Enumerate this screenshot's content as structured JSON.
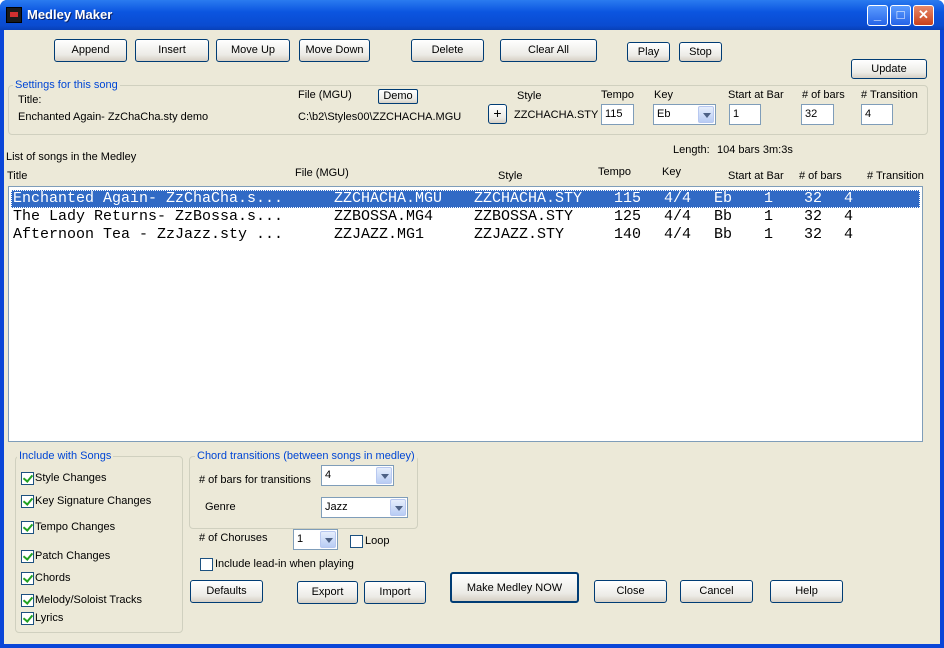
{
  "window": {
    "title": "Medley Maker"
  },
  "toolbar": {
    "append": "Append",
    "insert": "Insert",
    "move_up": "Move Up",
    "move_down": "Move Down",
    "delete": "Delete",
    "clear_all": "Clear All",
    "play": "Play",
    "stop": "Stop",
    "update": "Update"
  },
  "settings": {
    "group_title": "Settings for this song",
    "title_label": "Title:",
    "title_value": "Enchanted Again- ZzChaCha.sty demo",
    "file_label": "File (MGU)",
    "demo_button": "Demo",
    "file_value": "C:\\b2\\Styles00\\ZZCHACHA.MGU",
    "plus_button": "+",
    "style_label": "Style",
    "style_value": "ZZCHACHA.STY",
    "tempo_label": "Tempo",
    "tempo_value": "115",
    "key_label": "Key",
    "key_value": "Eb",
    "start_label": "Start at Bar",
    "start_value": "1",
    "bars_label": "# of bars",
    "bars_value": "32",
    "transition_label": "# Transition",
    "transition_value": "4"
  },
  "list": {
    "heading": "List of songs in the Medley",
    "length_label": "Length:",
    "length_value": "104 bars  3m:3s",
    "columns": {
      "title": "Title",
      "file": "File (MGU)",
      "style": "Style",
      "tempo": "Tempo",
      "key": "Key",
      "start": "Start at Bar",
      "bars": "# of bars",
      "transition": "# Transition"
    },
    "rows": [
      {
        "title": "Enchanted Again- ZzChaCha.s...",
        "file": "ZZCHACHA.MGU",
        "style": "ZZCHACHA.STY",
        "tempo": "115",
        "time": "4/4",
        "key": "Eb",
        "start": "1",
        "bars": "32",
        "transition": "4"
      },
      {
        "title": "The Lady Returns- ZzBossa.s...",
        "file": "ZZBOSSA.MG4",
        "style": "ZZBOSSA.STY",
        "tempo": "125",
        "time": "4/4",
        "key": "Bb",
        "start": "1",
        "bars": "32",
        "transition": "4"
      },
      {
        "title": "Afternoon Tea - ZzJazz.sty ...",
        "file": "ZZJAZZ.MG1",
        "style": "ZZJAZZ.STY",
        "tempo": "140",
        "time": "4/4",
        "key": "Bb",
        "start": "1",
        "bars": "32",
        "transition": "4"
      }
    ]
  },
  "include": {
    "group_title": "Include with Songs",
    "items": [
      {
        "label": "Style Changes",
        "checked": true
      },
      {
        "label": "Key Signature Changes",
        "checked": true
      },
      {
        "label": "Tempo Changes",
        "checked": true
      },
      {
        "label": "Patch Changes",
        "checked": true
      },
      {
        "label": "Chords",
        "checked": true
      },
      {
        "label": "Melody/Soloist Tracks",
        "checked": true
      },
      {
        "label": "Lyrics",
        "checked": true
      }
    ]
  },
  "transitions": {
    "group_title": "Chord transitions (between songs in medley)",
    "bars_label": "# of bars for transitions",
    "bars_value": "4",
    "genre_label": "Genre",
    "genre_value": "Jazz"
  },
  "choruses": {
    "label": "# of Choruses",
    "value": "1",
    "loop_label": "Loop",
    "loop_checked": false
  },
  "leadin": {
    "label": "Include lead-in when playing",
    "checked": false
  },
  "bottom": {
    "defaults": "Defaults",
    "export": "Export",
    "import": "Import",
    "make": "Make Medley NOW",
    "close": "Close",
    "cancel": "Cancel",
    "help": "Help"
  }
}
